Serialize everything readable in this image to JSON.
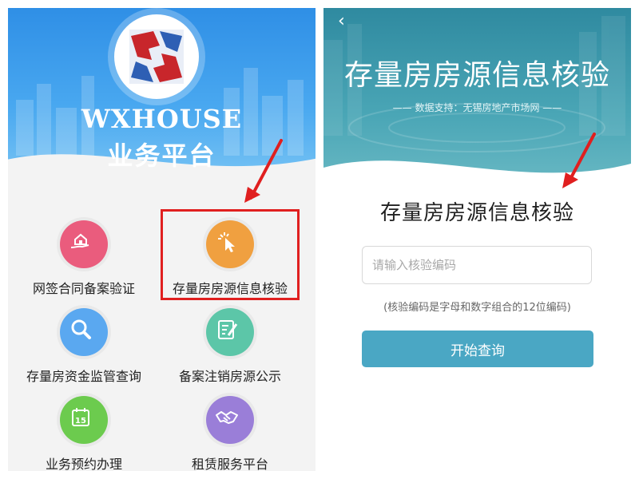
{
  "left": {
    "brand_en": "WXHOUSE",
    "brand_cn": "业务平台",
    "items": [
      {
        "label": "网签合同备案验证",
        "icon": "house-hand-icon",
        "color": "#ea5c7d"
      },
      {
        "label": "存量房房源信息核验",
        "icon": "cursor-click-icon",
        "color": "#f0a040"
      },
      {
        "label": "存量房资金监管查询",
        "icon": "magnifier-icon",
        "color": "#5aa8f0"
      },
      {
        "label": "备案注销房源公示",
        "icon": "document-edit-icon",
        "color": "#5cc6a8"
      },
      {
        "label": "业务预约办理",
        "icon": "calendar-icon",
        "color": "#6ccb4e"
      },
      {
        "label": "租赁服务平台",
        "icon": "handshake-icon",
        "color": "#9a7ed8"
      }
    ],
    "calendar_day": "15"
  },
  "right": {
    "back": "‹",
    "header_title": "存量房房源信息核验",
    "support": "—— 数据支持：无锡房地产市场网 ——",
    "title": "存量房房源信息核验",
    "input_placeholder": "请输入核验编码",
    "hint": "(核验编码是字母和数字组合的12位编码)",
    "button": "开始查询"
  },
  "colors": {
    "annotation": "#e01f1f",
    "button": "#4aa7c4"
  }
}
